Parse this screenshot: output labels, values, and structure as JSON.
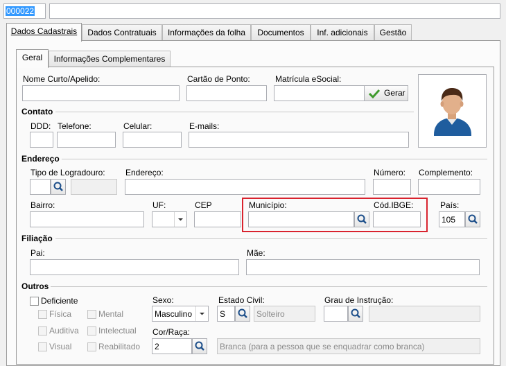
{
  "top": {
    "code_value": "000022",
    "name_value": ""
  },
  "tabs": [
    "Dados Cadastrais",
    "Dados Contratuais",
    "Informações da folha",
    "Documentos",
    "Inf. adicionais",
    "Gestão"
  ],
  "subtabs": [
    "Geral",
    "Informações Complementares"
  ],
  "fields": {
    "nome_curto": {
      "label": "Nome Curto/Apelido:",
      "value": ""
    },
    "cartao_ponto": {
      "label": "Cartão de Ponto:",
      "value": ""
    },
    "matricula": {
      "label": "Matrícula eSocial:",
      "value": "",
      "button": "Gerar"
    }
  },
  "contato": {
    "title": "Contato",
    "ddd": "DDD:",
    "telefone": "Telefone:",
    "celular": "Celular:",
    "emails": "E-mails:"
  },
  "endereco": {
    "title": "Endereço",
    "tipo_logradouro": "Tipo de Logradouro:",
    "endereco": "Endereço:",
    "numero": "Número:",
    "complemento": "Complemento:",
    "bairro": "Bairro:",
    "uf": "UF:",
    "cep": "CEP",
    "municipio": "Município:",
    "cod_ibge": "Cód.IBGE:",
    "pais": "País:",
    "pais_value": "105"
  },
  "filiacao": {
    "title": "Filiação",
    "pai": "Pai:",
    "mae": "Mãe:"
  },
  "outros": {
    "title": "Outros",
    "deficiente": "Deficiente",
    "fisica": "Física",
    "mental": "Mental",
    "auditiva": "Auditiva",
    "intelectual": "Intelectual",
    "visual": "Visual",
    "reabilitado": "Reabilitado",
    "sexo_label": "Sexo:",
    "sexo_value": "Masculino",
    "estado_civil_label": "Estado Civil:",
    "estado_civil_code": "S",
    "estado_civil_desc": "Solteiro",
    "grau_label": "Grau de Instrução:",
    "grau_code": "",
    "grau_desc": "",
    "cor_label": "Cor/Raça:",
    "cor_code": "2",
    "cor_desc": "Branca (para a pessoa que se enquadrar como branca)"
  },
  "colors": {
    "highlight": "#d9232e",
    "selection": "#3399ff",
    "accent_check": "#3f9a2c"
  }
}
